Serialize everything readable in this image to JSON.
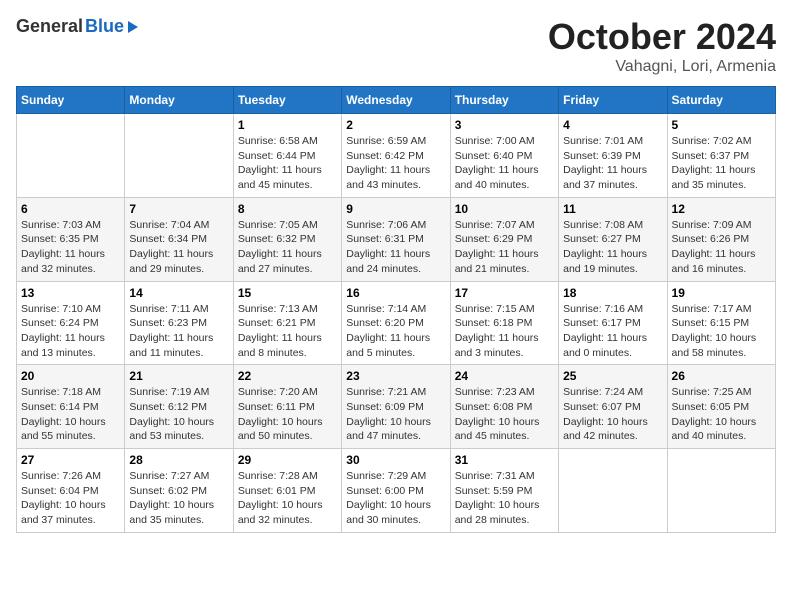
{
  "logo": {
    "general": "General",
    "blue": "Blue"
  },
  "header": {
    "month": "October 2024",
    "location": "Vahagni, Lori, Armenia"
  },
  "weekdays": [
    "Sunday",
    "Monday",
    "Tuesday",
    "Wednesday",
    "Thursday",
    "Friday",
    "Saturday"
  ],
  "weeks": [
    [
      {
        "day": "",
        "sunrise": "",
        "sunset": "",
        "daylight": ""
      },
      {
        "day": "",
        "sunrise": "",
        "sunset": "",
        "daylight": ""
      },
      {
        "day": "1",
        "sunrise": "Sunrise: 6:58 AM",
        "sunset": "Sunset: 6:44 PM",
        "daylight": "Daylight: 11 hours and 45 minutes."
      },
      {
        "day": "2",
        "sunrise": "Sunrise: 6:59 AM",
        "sunset": "Sunset: 6:42 PM",
        "daylight": "Daylight: 11 hours and 43 minutes."
      },
      {
        "day": "3",
        "sunrise": "Sunrise: 7:00 AM",
        "sunset": "Sunset: 6:40 PM",
        "daylight": "Daylight: 11 hours and 40 minutes."
      },
      {
        "day": "4",
        "sunrise": "Sunrise: 7:01 AM",
        "sunset": "Sunset: 6:39 PM",
        "daylight": "Daylight: 11 hours and 37 minutes."
      },
      {
        "day": "5",
        "sunrise": "Sunrise: 7:02 AM",
        "sunset": "Sunset: 6:37 PM",
        "daylight": "Daylight: 11 hours and 35 minutes."
      }
    ],
    [
      {
        "day": "6",
        "sunrise": "Sunrise: 7:03 AM",
        "sunset": "Sunset: 6:35 PM",
        "daylight": "Daylight: 11 hours and 32 minutes."
      },
      {
        "day": "7",
        "sunrise": "Sunrise: 7:04 AM",
        "sunset": "Sunset: 6:34 PM",
        "daylight": "Daylight: 11 hours and 29 minutes."
      },
      {
        "day": "8",
        "sunrise": "Sunrise: 7:05 AM",
        "sunset": "Sunset: 6:32 PM",
        "daylight": "Daylight: 11 hours and 27 minutes."
      },
      {
        "day": "9",
        "sunrise": "Sunrise: 7:06 AM",
        "sunset": "Sunset: 6:31 PM",
        "daylight": "Daylight: 11 hours and 24 minutes."
      },
      {
        "day": "10",
        "sunrise": "Sunrise: 7:07 AM",
        "sunset": "Sunset: 6:29 PM",
        "daylight": "Daylight: 11 hours and 21 minutes."
      },
      {
        "day": "11",
        "sunrise": "Sunrise: 7:08 AM",
        "sunset": "Sunset: 6:27 PM",
        "daylight": "Daylight: 11 hours and 19 minutes."
      },
      {
        "day": "12",
        "sunrise": "Sunrise: 7:09 AM",
        "sunset": "Sunset: 6:26 PM",
        "daylight": "Daylight: 11 hours and 16 minutes."
      }
    ],
    [
      {
        "day": "13",
        "sunrise": "Sunrise: 7:10 AM",
        "sunset": "Sunset: 6:24 PM",
        "daylight": "Daylight: 11 hours and 13 minutes."
      },
      {
        "day": "14",
        "sunrise": "Sunrise: 7:11 AM",
        "sunset": "Sunset: 6:23 PM",
        "daylight": "Daylight: 11 hours and 11 minutes."
      },
      {
        "day": "15",
        "sunrise": "Sunrise: 7:13 AM",
        "sunset": "Sunset: 6:21 PM",
        "daylight": "Daylight: 11 hours and 8 minutes."
      },
      {
        "day": "16",
        "sunrise": "Sunrise: 7:14 AM",
        "sunset": "Sunset: 6:20 PM",
        "daylight": "Daylight: 11 hours and 5 minutes."
      },
      {
        "day": "17",
        "sunrise": "Sunrise: 7:15 AM",
        "sunset": "Sunset: 6:18 PM",
        "daylight": "Daylight: 11 hours and 3 minutes."
      },
      {
        "day": "18",
        "sunrise": "Sunrise: 7:16 AM",
        "sunset": "Sunset: 6:17 PM",
        "daylight": "Daylight: 11 hours and 0 minutes."
      },
      {
        "day": "19",
        "sunrise": "Sunrise: 7:17 AM",
        "sunset": "Sunset: 6:15 PM",
        "daylight": "Daylight: 10 hours and 58 minutes."
      }
    ],
    [
      {
        "day": "20",
        "sunrise": "Sunrise: 7:18 AM",
        "sunset": "Sunset: 6:14 PM",
        "daylight": "Daylight: 10 hours and 55 minutes."
      },
      {
        "day": "21",
        "sunrise": "Sunrise: 7:19 AM",
        "sunset": "Sunset: 6:12 PM",
        "daylight": "Daylight: 10 hours and 53 minutes."
      },
      {
        "day": "22",
        "sunrise": "Sunrise: 7:20 AM",
        "sunset": "Sunset: 6:11 PM",
        "daylight": "Daylight: 10 hours and 50 minutes."
      },
      {
        "day": "23",
        "sunrise": "Sunrise: 7:21 AM",
        "sunset": "Sunset: 6:09 PM",
        "daylight": "Daylight: 10 hours and 47 minutes."
      },
      {
        "day": "24",
        "sunrise": "Sunrise: 7:23 AM",
        "sunset": "Sunset: 6:08 PM",
        "daylight": "Daylight: 10 hours and 45 minutes."
      },
      {
        "day": "25",
        "sunrise": "Sunrise: 7:24 AM",
        "sunset": "Sunset: 6:07 PM",
        "daylight": "Daylight: 10 hours and 42 minutes."
      },
      {
        "day": "26",
        "sunrise": "Sunrise: 7:25 AM",
        "sunset": "Sunset: 6:05 PM",
        "daylight": "Daylight: 10 hours and 40 minutes."
      }
    ],
    [
      {
        "day": "27",
        "sunrise": "Sunrise: 7:26 AM",
        "sunset": "Sunset: 6:04 PM",
        "daylight": "Daylight: 10 hours and 37 minutes."
      },
      {
        "day": "28",
        "sunrise": "Sunrise: 7:27 AM",
        "sunset": "Sunset: 6:02 PM",
        "daylight": "Daylight: 10 hours and 35 minutes."
      },
      {
        "day": "29",
        "sunrise": "Sunrise: 7:28 AM",
        "sunset": "Sunset: 6:01 PM",
        "daylight": "Daylight: 10 hours and 32 minutes."
      },
      {
        "day": "30",
        "sunrise": "Sunrise: 7:29 AM",
        "sunset": "Sunset: 6:00 PM",
        "daylight": "Daylight: 10 hours and 30 minutes."
      },
      {
        "day": "31",
        "sunrise": "Sunrise: 7:31 AM",
        "sunset": "Sunset: 5:59 PM",
        "daylight": "Daylight: 10 hours and 28 minutes."
      },
      {
        "day": "",
        "sunrise": "",
        "sunset": "",
        "daylight": ""
      },
      {
        "day": "",
        "sunrise": "",
        "sunset": "",
        "daylight": ""
      }
    ]
  ]
}
